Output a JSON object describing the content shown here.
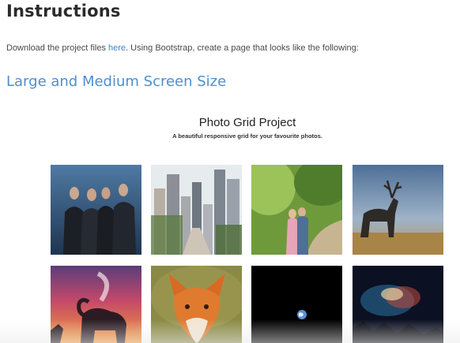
{
  "instructions": {
    "heading": "Instructions",
    "intro_before": "Download the project files ",
    "intro_link": "here",
    "intro_after": ". Using Bootstrap, create a page that looks like the following:",
    "subheading": "Large and Medium Screen Size"
  },
  "preview": {
    "title": "Photo Grid Project",
    "subtitle": "A beautiful responsive grid for your favourite photos."
  },
  "photos": [
    "band-photo",
    "city-photo",
    "couple-photo",
    "deer-photo",
    "elephant-photo",
    "fox-photo",
    "earth-photo",
    "galaxy-photo"
  ]
}
